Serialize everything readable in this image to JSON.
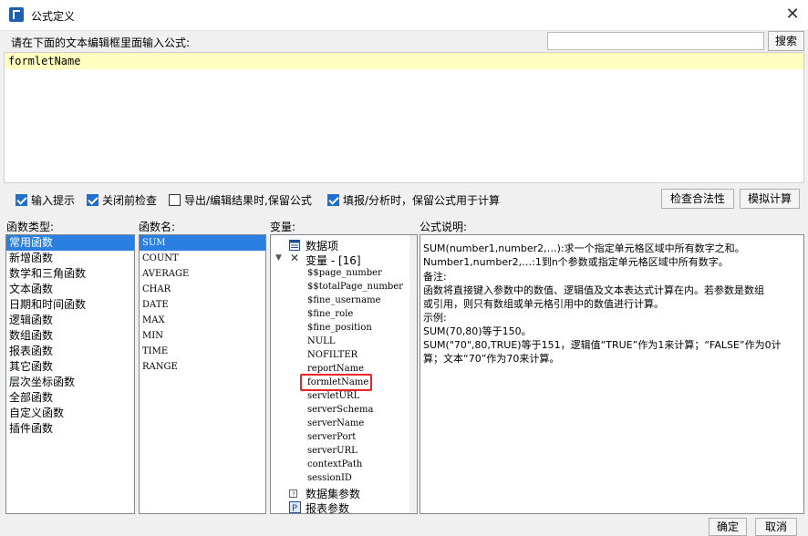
{
  "window": {
    "title": "公式定义",
    "close_label": "✕"
  },
  "prompt": {
    "label": "请在下面的文本编辑框里面输入公式:"
  },
  "search": {
    "value": "",
    "button_label": "搜索"
  },
  "editor": {
    "text": "formletName"
  },
  "options": [
    {
      "label": "输入提示",
      "checked": true
    },
    {
      "label": "关闭前检查",
      "checked": true
    },
    {
      "label": "导出/编辑结果时,保留公式",
      "checked": false
    },
    {
      "label": "填报/分析时，保留公式用于计算",
      "checked": true
    }
  ],
  "buttons": {
    "check": "检查合法性",
    "simulate": "模拟计算",
    "ok": "确定",
    "cancel": "取消"
  },
  "panels": {
    "func_type": "函数类型:",
    "func_name": "函数名:",
    "variables": "变量:",
    "description": "公式说明:"
  },
  "func_types": [
    "常用函数",
    "新增函数",
    "数学和三角函数",
    "文本函数",
    "日期和时间函数",
    "逻辑函数",
    "数组函数",
    "报表函数",
    "其它函数",
    "层次坐标函数",
    "全部函数",
    "自定义函数",
    "插件函数"
  ],
  "func_names": [
    "SUM",
    "COUNT",
    "AVERAGE",
    "CHAR",
    "DATE",
    "MAX",
    "MIN",
    "TIME",
    "RANGE"
  ],
  "tree": {
    "data_items": "数据项",
    "variables_header": "变量 - [16]",
    "variables": [
      "$$page_number",
      "$$totalPage_number",
      "$fine_username",
      "$fine_role",
      "$fine_position",
      "NULL",
      "NOFILTER",
      "reportName",
      "formletName",
      "servletURL",
      "serverSchema",
      "serverName",
      "serverPort",
      "serverURL",
      "contextPath",
      "sessionID"
    ],
    "dataset_params": "数据集参数",
    "report_params": "报表参数"
  },
  "description_lines": [
    "SUM(number1,number2,…):求一个指定单元格区域中所有数字之和。",
    "Number1,number2,…:1到n个参数或指定单元格区域中所有数字。",
    "备注:",
    "函数将直接键入参数中的数值、逻辑值及文本表达式计算在内。若参数是数组",
    "或引用，则只有数组或单元格引用中的数值进行计算。",
    "示例:",
    "SUM(70,80)等于150。",
    "SUM(\"70\",80,TRUE)等于151，逻辑值“TRUE”作为1来计算；“FALSE”作为0计",
    "算；文本“70”作为70来计算。"
  ]
}
